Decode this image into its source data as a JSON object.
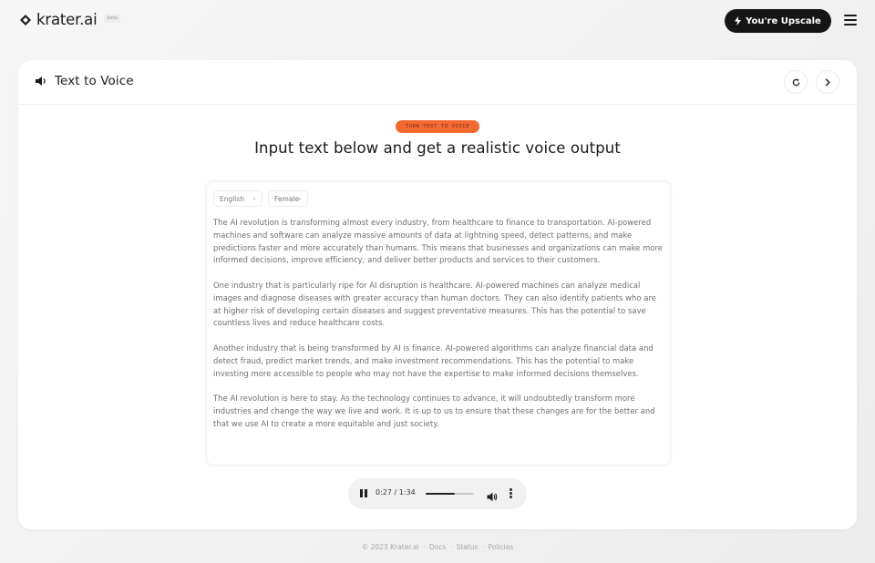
{
  "brand": {
    "name": "krater.ai",
    "badge": "beta"
  },
  "topbar": {
    "upscale_label": "You're Upscale"
  },
  "card": {
    "title": "Text to Voice",
    "tag": "TURN TEXT TO VOICE",
    "headline": "Input text below and get a realistic voice output"
  },
  "editor": {
    "language": "English",
    "voice": "Female",
    "paragraphs": [
      "The AI revolution is transforming almost every industry, from healthcare to finance to transportation. AI-powered machines and software can analyze massive amounts of data at lightning speed, detect patterns, and make predictions faster and more accurately than humans. This means that businesses and organizations can make more informed decisions, improve efficiency, and deliver better products and services to their customers.",
      "One industry that is particularly ripe for AI disruption is healthcare. AI-powered machines can analyze medical images and diagnose diseases with greater accuracy than human doctors. They can also identify patients who are at higher risk of developing certain diseases and suggest preventative measures. This has the potential to save countless lives and reduce healthcare costs.",
      "Another industry that is being transformed by AI is finance. AI-powered algorithms can analyze financial data and detect fraud, predict market trends, and make investment recommendations. This has the potential to make investing more accessible to people who may not have the expertise to make informed decisions themselves.",
      "The AI revolution is here to stay. As the technology continues to advance, it will undoubtedly transform more industries and change the way we live and work. It is up to us to ensure that these changes are for the better and that we use AI to create a more equitable and just society."
    ]
  },
  "player": {
    "time": "0:27 / 1:34",
    "progress": 0.6
  },
  "footer": {
    "copyright": "© 2023 Krater.ai",
    "sep": "·",
    "links": [
      "Docs",
      "Status",
      "Policies"
    ]
  },
  "colors": {
    "accent": "#f26a32",
    "dark": "#151515"
  }
}
